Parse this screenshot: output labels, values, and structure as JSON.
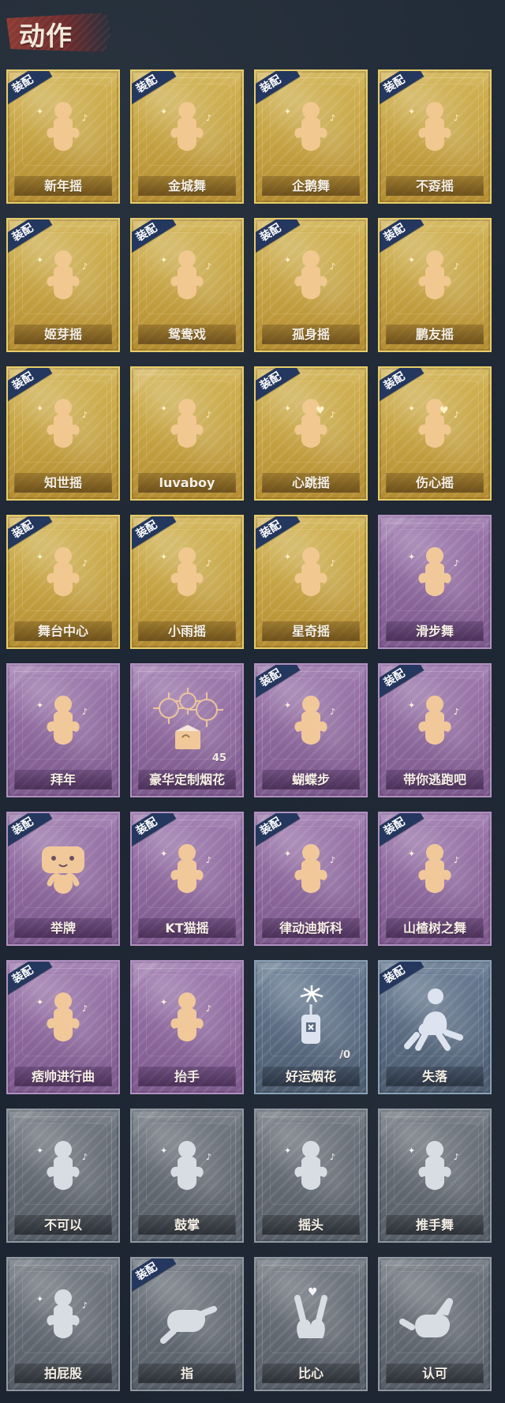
{
  "header": {
    "title": "动作"
  },
  "cards": [
    {
      "label": "新年摇",
      "theme": "gold",
      "equipped": true,
      "icon": "pose-new-year-icon",
      "count": ""
    },
    {
      "label": "金城舞",
      "theme": "gold",
      "equipped": true,
      "icon": "pose-jincheng-dance-icon",
      "count": ""
    },
    {
      "label": "企鹅舞",
      "theme": "gold",
      "equipped": true,
      "icon": "pose-penguin-dance-icon",
      "count": ""
    },
    {
      "label": "不孬摇",
      "theme": "gold",
      "equipped": true,
      "icon": "pose-bunao-shake-icon",
      "count": ""
    },
    {
      "label": "姬芽摇",
      "theme": "gold",
      "equipped": true,
      "icon": "pose-jiya-shake-icon",
      "count": ""
    },
    {
      "label": "鸳鸯戏",
      "theme": "gold",
      "equipped": true,
      "icon": "pose-yuanyang-play-icon",
      "count": ""
    },
    {
      "label": "孤身摇",
      "theme": "gold",
      "equipped": true,
      "icon": "pose-alone-shake-icon",
      "count": ""
    },
    {
      "label": "鹏友摇",
      "theme": "gold",
      "equipped": true,
      "icon": "pose-pengyou-shake-icon",
      "count": ""
    },
    {
      "label": "知世摇",
      "theme": "gold",
      "equipped": true,
      "icon": "pose-zhishi-shake-icon",
      "count": ""
    },
    {
      "label": "luvaboy",
      "theme": "gold",
      "equipped": false,
      "icon": "pose-luvaboy-icon",
      "count": ""
    },
    {
      "label": "心跳摇",
      "theme": "gold",
      "equipped": true,
      "icon": "pose-heartbeat-shake-icon",
      "count": ""
    },
    {
      "label": "伤心摇",
      "theme": "gold",
      "equipped": true,
      "icon": "pose-sad-shake-icon",
      "count": ""
    },
    {
      "label": "舞台中心",
      "theme": "gold",
      "equipped": true,
      "icon": "pose-stage-center-icon",
      "count": ""
    },
    {
      "label": "小雨摇",
      "theme": "gold",
      "equipped": true,
      "icon": "pose-light-rain-shake-icon",
      "count": ""
    },
    {
      "label": "星奇摇",
      "theme": "gold",
      "equipped": true,
      "icon": "pose-star-wonder-shake-icon",
      "count": ""
    },
    {
      "label": "滑步舞",
      "theme": "purple",
      "equipped": false,
      "icon": "pose-slide-dance-icon",
      "count": ""
    },
    {
      "label": "拜年",
      "theme": "purple",
      "equipped": false,
      "icon": "pose-new-year-greeting-icon",
      "count": ""
    },
    {
      "label": "豪华定制烟花",
      "theme": "purple",
      "equipped": false,
      "icon": "fireworks-box-icon",
      "count": "45"
    },
    {
      "label": "蝴蝶步",
      "theme": "purple",
      "equipped": true,
      "icon": "pose-butterfly-step-icon",
      "count": ""
    },
    {
      "label": "带你逃跑吧",
      "theme": "purple",
      "equipped": true,
      "icon": "pose-run-away-icon",
      "count": ""
    },
    {
      "label": "举牌",
      "theme": "purple",
      "equipped": true,
      "icon": "pose-hold-sign-icon",
      "count": ""
    },
    {
      "label": "KT猫摇",
      "theme": "purple",
      "equipped": true,
      "icon": "pose-kt-cat-shake-icon",
      "count": ""
    },
    {
      "label": "律动迪斯科",
      "theme": "purple",
      "equipped": true,
      "icon": "pose-rhythm-disco-icon",
      "count": ""
    },
    {
      "label": "山楂树之舞",
      "theme": "purple",
      "equipped": true,
      "icon": "pose-hawthorn-dance-icon",
      "count": ""
    },
    {
      "label": "痞帅进行曲",
      "theme": "purple",
      "equipped": true,
      "icon": "pose-cool-march-icon",
      "count": ""
    },
    {
      "label": "抬手",
      "theme": "purple",
      "equipped": false,
      "icon": "pose-raise-hand-icon",
      "count": ""
    },
    {
      "label": "好运烟花",
      "theme": "blue",
      "equipped": false,
      "icon": "lucky-firework-icon",
      "count": "/0"
    },
    {
      "label": "失落",
      "theme": "blue",
      "equipped": true,
      "icon": "pose-lost-icon",
      "count": ""
    },
    {
      "label": "不可以",
      "theme": "gray",
      "equipped": false,
      "icon": "pose-no-icon",
      "count": ""
    },
    {
      "label": "鼓掌",
      "theme": "gray",
      "equipped": false,
      "icon": "pose-clap-icon",
      "count": ""
    },
    {
      "label": "摇头",
      "theme": "gray",
      "equipped": false,
      "icon": "pose-shake-head-icon",
      "count": ""
    },
    {
      "label": "推手舞",
      "theme": "gray",
      "equipped": false,
      "icon": "pose-push-hands-dance-icon",
      "count": ""
    },
    {
      "label": "拍屁股",
      "theme": "gray",
      "equipped": false,
      "icon": "pose-pat-butt-icon",
      "count": ""
    },
    {
      "label": "指",
      "theme": "gray",
      "equipped": true,
      "icon": "pose-point-icon",
      "count": ""
    },
    {
      "label": "比心",
      "theme": "gray",
      "equipped": false,
      "icon": "pose-heart-hands-icon",
      "count": ""
    },
    {
      "label": "认可",
      "theme": "gray",
      "equipped": false,
      "icon": "pose-approve-icon",
      "count": ""
    }
  ],
  "badge_text": "装配",
  "colors": {
    "gold": "#c7a646",
    "purple": "#8f6a9f",
    "blue": "#5b6d84",
    "gray": "#646b74",
    "badge": "#24375e",
    "title_bg": "#7c3231",
    "text": "#f6f0e6"
  }
}
